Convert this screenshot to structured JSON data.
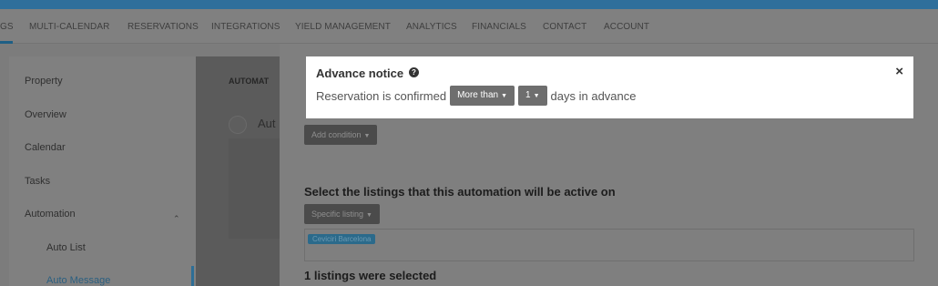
{
  "nav": {
    "items": [
      "GS",
      "MULTI-CALENDAR",
      "RESERVATIONS",
      "INTEGRATIONS",
      "YIELD MANAGEMENT",
      "ANALYTICS",
      "FINANCIALS",
      "CONTACT",
      "ACCOUNT"
    ]
  },
  "sidebar": {
    "items": [
      "Property",
      "Overview",
      "Calendar",
      "Tasks",
      "Automation",
      "Auto List",
      "Auto Message"
    ]
  },
  "middle": {
    "header": "AUTOMAT",
    "item_text": "Aut"
  },
  "content": {
    "add_condition": "Add condition",
    "listings_title": "Select the listings that this automation will be active on",
    "specific_listing": "Specific listing",
    "tag": "Ceviciri Barcelona",
    "selected_text": "1 listings were selected"
  },
  "modal": {
    "title": "Advance notice",
    "prefix": "Reservation is confirmed",
    "comparison": "More than",
    "number": "1",
    "suffix": "days in advance"
  },
  "colors": {
    "topbar": "#2f6f9b",
    "accent": "#2d6e96"
  }
}
